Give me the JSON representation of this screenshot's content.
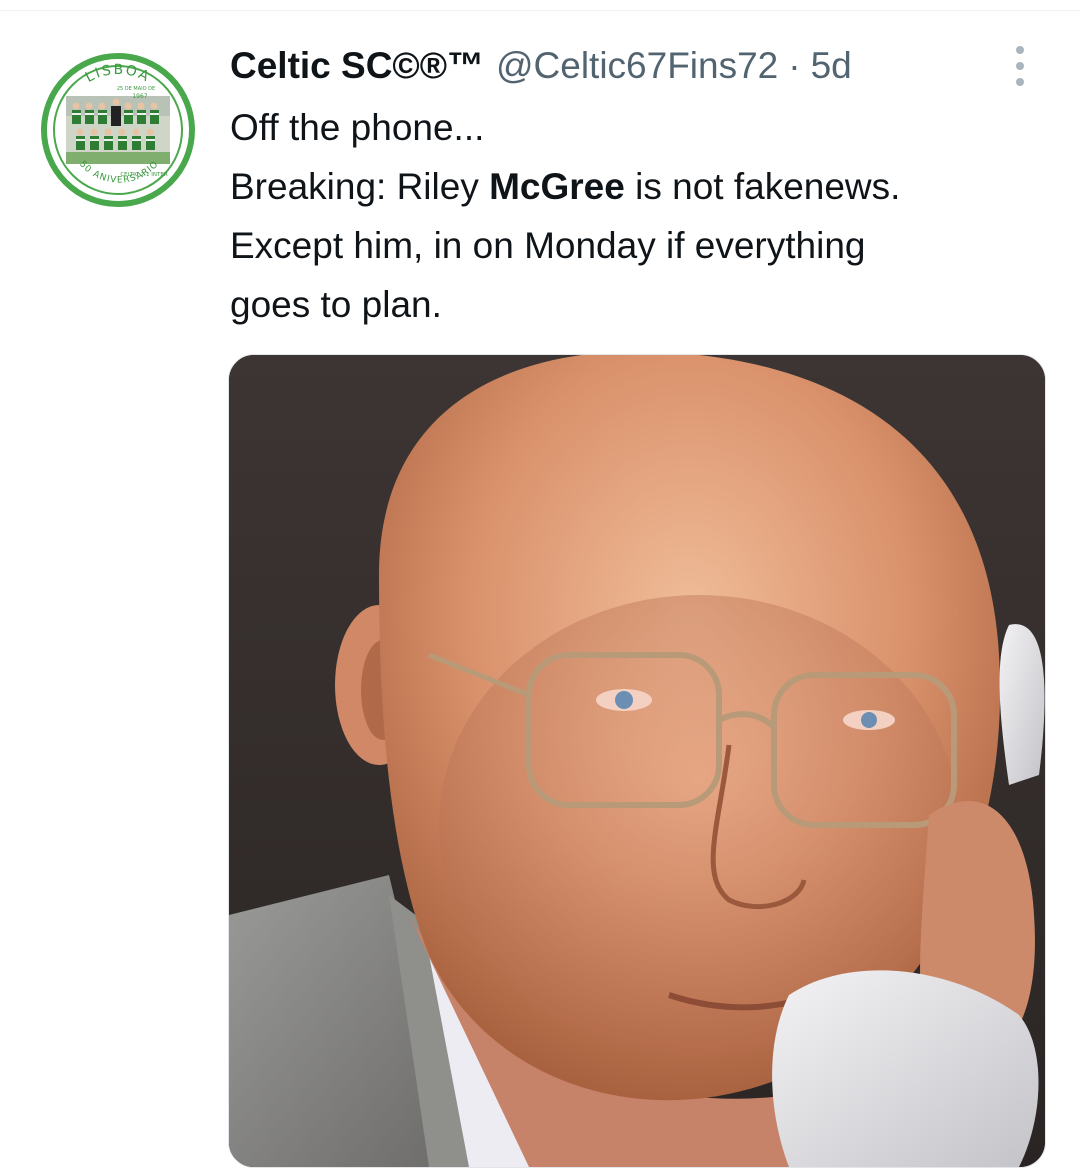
{
  "tweet": {
    "author": {
      "display_name": "Celtic SC©®™",
      "handle": "@Celtic67Fins72",
      "avatar_icon": "team-photo-badge-avatar",
      "avatar_text": {
        "top": "LISBOA",
        "date": "25 DE MAIO DE",
        "year": "1967",
        "score": "CELTIC 2-1 INTER",
        "bottom": "50 ANIVERSARIO"
      }
    },
    "separator": "·",
    "timestamp": "5d",
    "text": {
      "line1": "Off the phone...",
      "line2_before": "Breaking: Riley ",
      "line2_bold": "McGree",
      "line2_after": " is not fakenews.",
      "line3": "Except him, in on Monday if everything",
      "line4": "goes to plan."
    },
    "media": {
      "icon": "photo-man-on-telephone"
    }
  },
  "colors": {
    "text_primary": "#0f1419",
    "text_secondary": "#536471",
    "celtic_green": "#3a9a3f"
  }
}
